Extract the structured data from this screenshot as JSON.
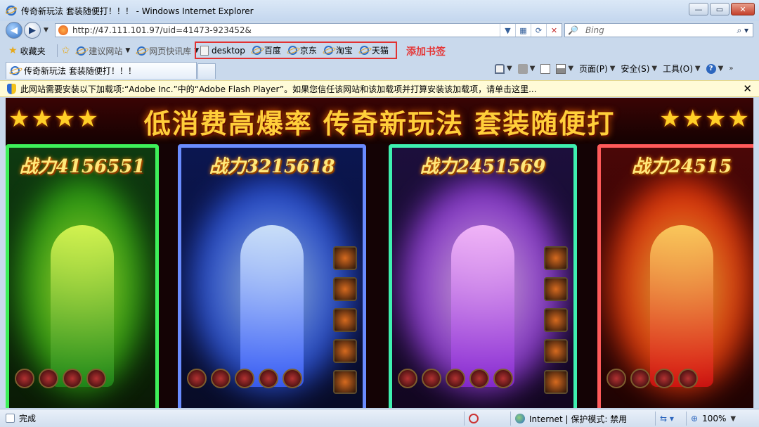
{
  "window": {
    "title": "传奇新玩法 套装随便打！！！ - Windows Internet Explorer",
    "buttons": [
      "—",
      "▭",
      "✕"
    ]
  },
  "address_bar": {
    "url": "http://47.111.101.97/uid=41473-923452&",
    "search_placeholder": "Bing"
  },
  "favorites_bar": {
    "favorites_label": "收藏夹",
    "suggested_sites": "建议网站",
    "web_slice_gallery": "网页快讯库",
    "bookmarks": [
      "desktop",
      "百度",
      "京东",
      "淘宝",
      "天猫"
    ],
    "annotation": "添加书签"
  },
  "tab": {
    "title": "传奇新玩法 套装随便打！！！"
  },
  "command_bar": {
    "page": "页面(P)",
    "safety": "安全(S)",
    "tools": "工具(O)"
  },
  "info_bar": {
    "message": "此网站需要安装以下加载项:“Adobe Inc.”中的“Adobe Flash Player”。如果您信任该网站和该加载项并打算安装该加载项，请单击这里..."
  },
  "banner": {
    "headline": "低消费高爆率 传奇新玩法 套装随便打",
    "stars": "★★★★",
    "cards": [
      {
        "power": "战力4156551"
      },
      {
        "power": "战力3215618"
      },
      {
        "power": "战力2451569"
      },
      {
        "power": "战力24515"
      }
    ]
  },
  "status_bar": {
    "done": "完成",
    "zone": "Internet | 保护模式: 禁用",
    "zoom": "100%"
  }
}
